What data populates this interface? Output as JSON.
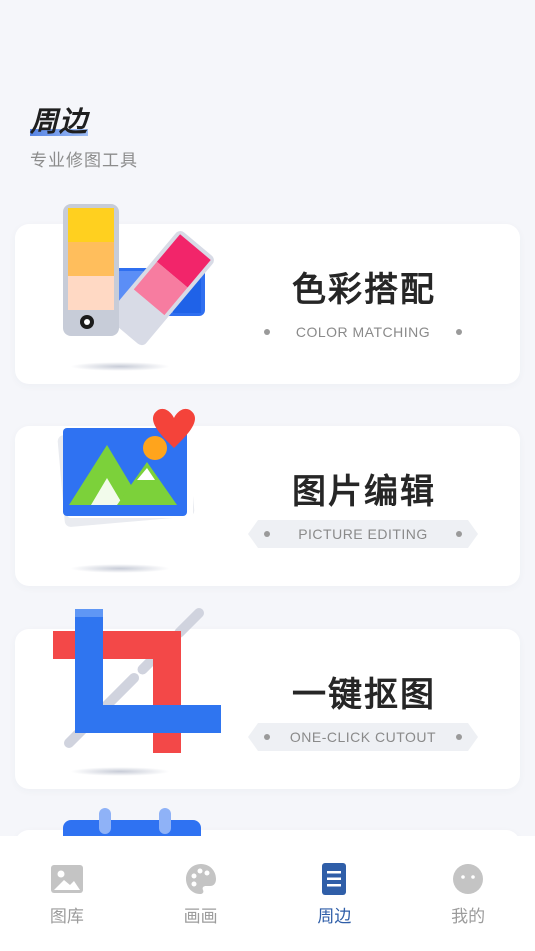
{
  "header": {
    "title": "周边",
    "subtitle": "专业修图工具"
  },
  "cards": [
    {
      "title": "色彩搭配",
      "subtitle": "COLOR MATCHING",
      "icon": "color-palette-icon"
    },
    {
      "title": "图片编辑",
      "subtitle": "PICTURE EDITING",
      "icon": "picture-edit-icon"
    },
    {
      "title": "一键抠图",
      "subtitle": "ONE-CLICK CUTOUT",
      "icon": "crop-icon"
    }
  ],
  "tabbar": {
    "items": [
      {
        "label": "图库",
        "icon": "gallery-icon",
        "active": false
      },
      {
        "label": "画画",
        "icon": "palette-icon",
        "active": false
      },
      {
        "label": "周边",
        "icon": "document-icon",
        "active": true
      },
      {
        "label": "我的",
        "icon": "profile-face-icon",
        "active": false
      }
    ],
    "active_color": "#2f5ea8",
    "inactive_color": "#c4c4c4"
  }
}
